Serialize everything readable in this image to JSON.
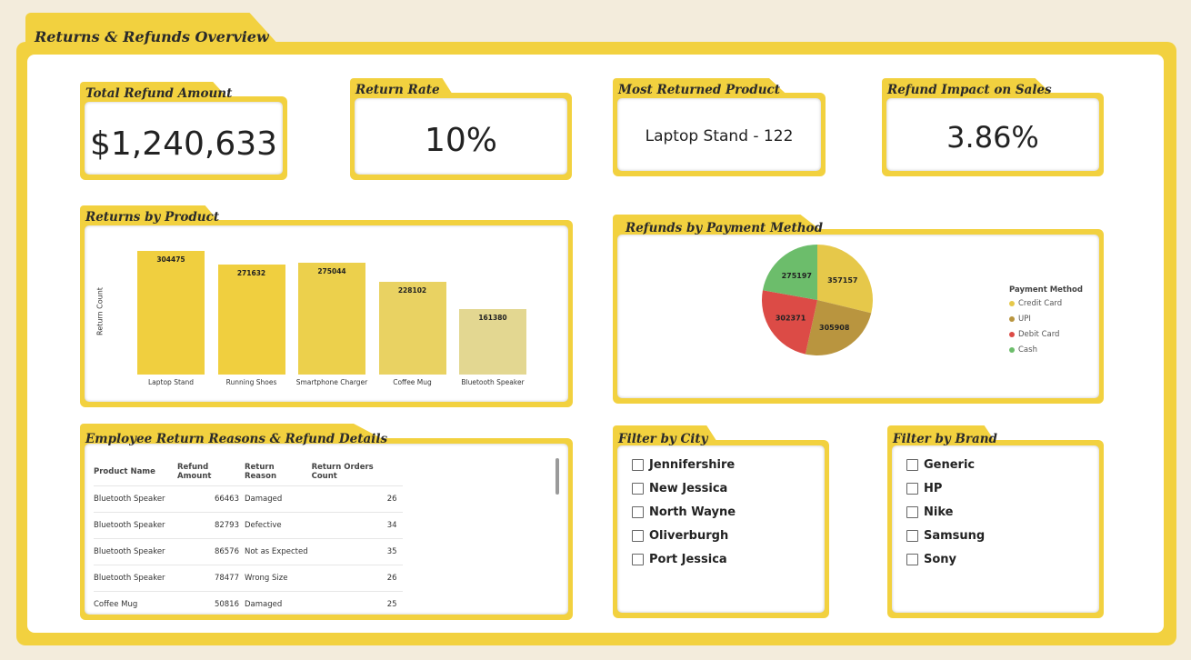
{
  "dashboard": {
    "title": "Returns & Refunds Overview"
  },
  "kpis": {
    "total_refund": {
      "title": "Total Refund Amount",
      "value": "$1,240,633"
    },
    "return_rate": {
      "title": "Return Rate",
      "value": "10%"
    },
    "most_returned": {
      "title": "Most Returned Product",
      "value": "Laptop Stand - 122"
    },
    "refund_impact": {
      "title": "Refund Impact on Sales",
      "value": "3.86%"
    }
  },
  "returns_by_product": {
    "title": "Returns by Product",
    "ylabel": "Return Count",
    "value_labels": [
      "304475",
      "271632",
      "275044",
      "228102",
      "161380"
    ]
  },
  "refunds_by_payment": {
    "title": "Refunds by Payment Method",
    "legend_title": "Payment Method",
    "slice_labels": [
      "357157",
      "305908",
      "302371",
      "275197"
    ]
  },
  "chart_data": [
    {
      "type": "bar",
      "title": "Returns by Product",
      "ylabel": "Return Count",
      "categories": [
        "Laptop Stand",
        "Running Shoes",
        "Smartphone Charger",
        "Coffee Mug",
        "Bluetooth Speaker"
      ],
      "values": [
        304475,
        271632,
        275044,
        228102,
        161380
      ],
      "colors": [
        "#f0cf3f",
        "#f0cf3f",
        "#ecd04c",
        "#e9d262",
        "#e3d791"
      ]
    },
    {
      "type": "pie",
      "title": "Refunds by Payment Method",
      "legend_title": "Payment Method",
      "labels": [
        "Credit Card",
        "UPI",
        "Debit Card",
        "Cash"
      ],
      "values": [
        357157,
        305908,
        302371,
        275197
      ],
      "colors": [
        "#e6c84a",
        "#b9953f",
        "#dc4b46",
        "#6cbd6b"
      ],
      "legend_placement": "right"
    }
  ],
  "details_table": {
    "title": "Employee Return Reasons & Refund Details",
    "headers": [
      "Product Name",
      "Refund Amount",
      "Return Reason",
      "Return Orders Count"
    ],
    "rows": [
      [
        "Bluetooth Speaker",
        "66463",
        "Damaged",
        "26"
      ],
      [
        "Bluetooth Speaker",
        "82793",
        "Defective",
        "34"
      ],
      [
        "Bluetooth Speaker",
        "86576",
        "Not as Expected",
        "35"
      ],
      [
        "Bluetooth Speaker",
        "78477",
        "Wrong Size",
        "26"
      ],
      [
        "Coffee Mug",
        "50816",
        "Damaged",
        "25"
      ]
    ]
  },
  "filter_city": {
    "title": "Filter by City",
    "options": [
      "Jennifershire",
      "New Jessica",
      "North Wayne",
      "Oliverburgh",
      "Port Jessica"
    ]
  },
  "filter_brand": {
    "title": "Filter by Brand",
    "options": [
      "Generic",
      "HP",
      "Nike",
      "Samsung",
      "Sony"
    ]
  }
}
